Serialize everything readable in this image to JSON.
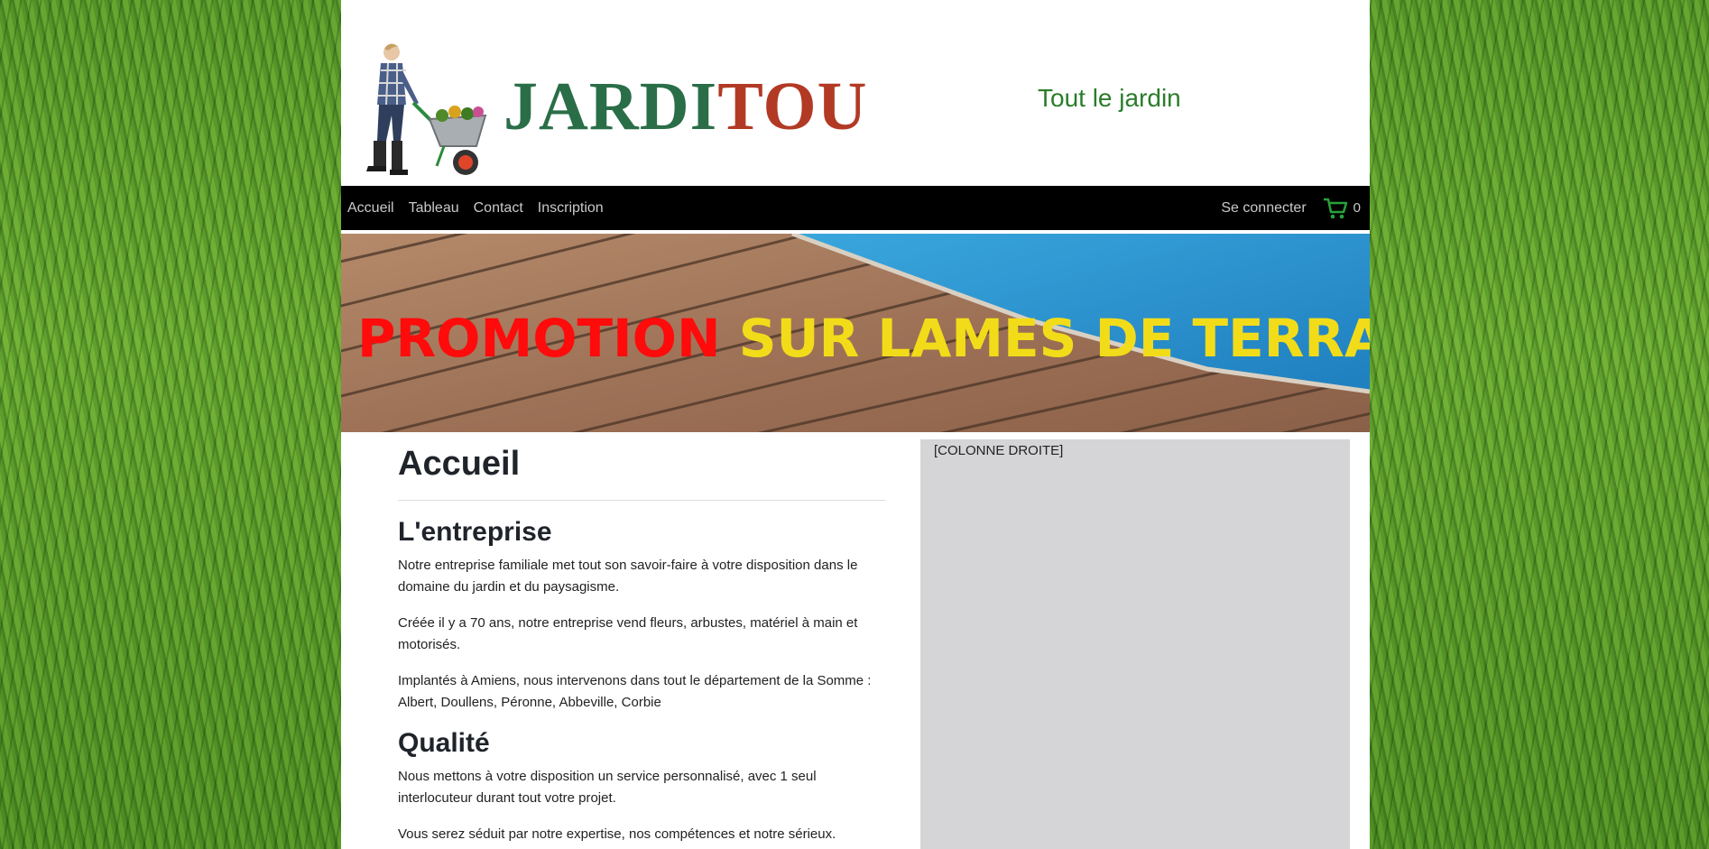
{
  "header": {
    "logo_part1": "JARDI",
    "logo_part2": "TOU",
    "tagline": "Tout le jardin"
  },
  "nav": {
    "items": [
      "Accueil",
      "Tableau",
      "Contact",
      "Inscription"
    ],
    "login_label": "Se connecter",
    "cart_count": "0"
  },
  "banner": {
    "word_red": "PROMOTION",
    "words_yellow": "SUR LAMES DE TERRASSE"
  },
  "main": {
    "title": "Accueil",
    "sections": [
      {
        "heading": "L'entreprise",
        "paragraphs": [
          "Notre entreprise familiale met tout son savoir-faire à votre disposition dans le domaine du jardin et du paysagisme.",
          "Créée il y a 70 ans, notre entreprise vend fleurs, arbustes, matériel à main et motorisés.",
          "Implantés à Amiens, nous intervenons dans tout le département de la Somme : Albert, Doullens, Péronne, Abbeville, Corbie"
        ]
      },
      {
        "heading": "Qualité",
        "paragraphs": [
          "Nous mettons à votre disposition un service personnalisé, avec 1 seul interlocuteur durant tout votre projet.",
          "Vous serez séduit par notre expertise, nos compétences et notre sérieux."
        ]
      }
    ]
  },
  "sidebar": {
    "label": "[COLONNE DROITE]"
  },
  "colors": {
    "nav_bg": "#000000",
    "logo_green": "#2a6e48",
    "logo_red": "#b23a24",
    "tagline_green": "#2a7d2a",
    "promo_red": "#ff0b0b",
    "promo_yellow": "#f2dc1a",
    "sidebar_bg": "#d5d5d7"
  }
}
